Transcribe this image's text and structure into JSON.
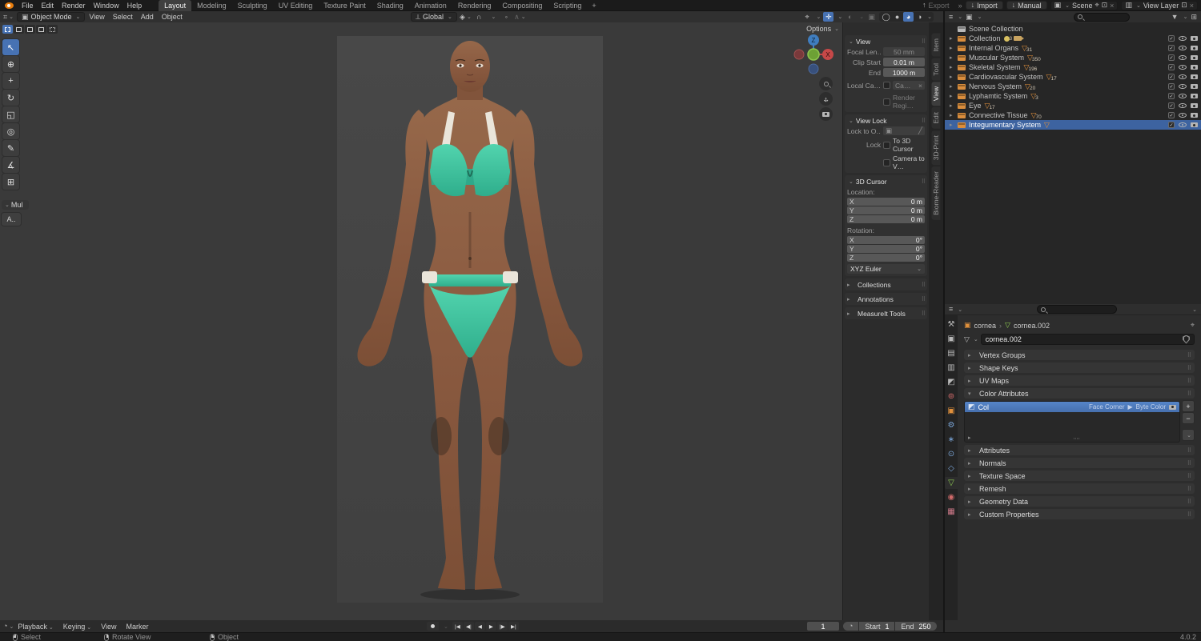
{
  "topbar": {
    "menus": [
      "File",
      "Edit",
      "Render",
      "Window",
      "Help"
    ],
    "workspaces": [
      {
        "label": "Layout",
        "active": true
      },
      {
        "label": "Modeling"
      },
      {
        "label": "Sculpting"
      },
      {
        "label": "UV Editing"
      },
      {
        "label": "Texture Paint"
      },
      {
        "label": "Shading"
      },
      {
        "label": "Animation"
      },
      {
        "label": "Rendering"
      },
      {
        "label": "Compositing"
      },
      {
        "label": "Scripting"
      }
    ],
    "new_workspace": "+",
    "export_label": "Export",
    "import_label": "Import",
    "manual_label": "Manual",
    "scene_label": "Scene",
    "view_layer_label": "View Layer"
  },
  "viewport_header": {
    "mode": "Object Mode",
    "menus": [
      "View",
      "Select",
      "Add",
      "Object"
    ],
    "orientation": "Global",
    "options_label": "Options"
  },
  "toolbar": {
    "tools": [
      {
        "name": "select-box",
        "glyph": "↖",
        "active": true
      },
      {
        "name": "cursor",
        "glyph": "⊕"
      },
      {
        "name": "move",
        "glyph": "+"
      },
      {
        "name": "rotate",
        "glyph": "↻"
      },
      {
        "name": "scale",
        "glyph": "◱"
      },
      {
        "name": "transform",
        "glyph": "◎"
      },
      {
        "name": "annotate",
        "glyph": "✎"
      },
      {
        "name": "measure",
        "glyph": "∡"
      },
      {
        "name": "add-cube",
        "glyph": "⊞"
      }
    ],
    "panel_label": "Mul",
    "panel_button": "A.."
  },
  "viewport": {
    "gizmo_z": "Z",
    "gizmo_x": "X"
  },
  "sidebar": {
    "tabs": [
      {
        "label": "Item"
      },
      {
        "label": "Tool"
      },
      {
        "label": "View",
        "active": true
      },
      {
        "label": "Edit"
      },
      {
        "label": "3D-Print"
      },
      {
        "label": "Biome-Reader"
      }
    ],
    "view": {
      "title": "View",
      "focal_label": "Focal Len…",
      "focal_value": "50 mm",
      "clip_label": "Clip Start",
      "clip_value": "0.01 m",
      "end_label": "End",
      "end_value": "1000 m",
      "local_label": "Local Ca…",
      "local_value": "Ca…",
      "render_region": "Render Regi…"
    },
    "view_lock": {
      "title": "View Lock",
      "lock_to": "Lock to O…",
      "lock_label": "Lock",
      "to_cursor": "To 3D Cursor",
      "camera_to": "Camera to V…"
    },
    "cursor": {
      "title": "3D Cursor",
      "location_label": "Location:",
      "location": [
        {
          "axis": "X",
          "value": "0 m"
        },
        {
          "axis": "Y",
          "value": "0 m"
        },
        {
          "axis": "Z",
          "value": "0 m"
        }
      ],
      "rotation_label": "Rotation:",
      "rotation": [
        {
          "axis": "X",
          "value": "0°"
        },
        {
          "axis": "Y",
          "value": "0°"
        },
        {
          "axis": "Z",
          "value": "0°"
        }
      ],
      "euler": "XYZ Euler"
    },
    "collapsed_panels": [
      "Collections",
      "Annotations",
      "MeasureIt Tools"
    ]
  },
  "outliner": {
    "root": "Scene Collection",
    "rows": [
      {
        "label": "Collection",
        "light_count": "3",
        "camera": true
      },
      {
        "label": "Internal Organs",
        "mesh": true,
        "mesh_count": "31"
      },
      {
        "label": "Muscular System",
        "mesh": true,
        "mesh_count": "350"
      },
      {
        "label": "Skeletal System",
        "mesh": true,
        "mesh_count": "196"
      },
      {
        "label": "Cardiovascular System",
        "mesh": true,
        "mesh_count": "17"
      },
      {
        "label": "Nervous System",
        "mesh": true,
        "mesh_count": "20"
      },
      {
        "label": "Lyphamtic System",
        "mesh": true,
        "mesh_count": "3"
      },
      {
        "label": "Eye",
        "mesh": true,
        "mesh_count": "17"
      },
      {
        "label": "Connective Tissue",
        "mesh": true,
        "mesh_count": "70"
      },
      {
        "label": "Integumentary System",
        "mesh": true,
        "mesh_count": "",
        "selected": true
      }
    ]
  },
  "properties": {
    "tabs": [
      {
        "name": "tool",
        "glyph": "⚒",
        "cls": "c-gray"
      },
      {
        "name": "render",
        "glyph": "▣",
        "cls": "c-gray"
      },
      {
        "name": "output",
        "glyph": "▤",
        "cls": "c-gray"
      },
      {
        "name": "view-layer",
        "glyph": "▥",
        "cls": "c-gray"
      },
      {
        "name": "scene",
        "glyph": "◩",
        "cls": "c-gray"
      },
      {
        "name": "world",
        "glyph": "⊚",
        "cls": "c-red"
      },
      {
        "name": "object",
        "glyph": "▣",
        "cls": "c-orange"
      },
      {
        "name": "modifiers",
        "glyph": "⚙",
        "cls": "c-blue"
      },
      {
        "name": "particles",
        "glyph": "∗",
        "cls": "c-blue"
      },
      {
        "name": "physics",
        "glyph": "⊙",
        "cls": "c-blue"
      },
      {
        "name": "constraints",
        "glyph": "◇",
        "cls": "c-blue"
      },
      {
        "name": "object-data",
        "glyph": "▽",
        "cls": "c-green",
        "active": true
      },
      {
        "name": "material",
        "glyph": "◉",
        "cls": "c-red"
      },
      {
        "name": "texture",
        "glyph": "▦",
        "cls": "c-pink"
      }
    ],
    "breadcrumb": {
      "object": "cornea",
      "sep": "›",
      "data": "cornea.002"
    },
    "name_value": "cornea.002",
    "panels_above": [
      "Vertex Groups",
      "Shape Keys",
      "UV Maps"
    ],
    "color_attributes": {
      "title": "Color Attributes",
      "row": {
        "name": "Col",
        "domain": "Face Corner",
        "arrow": "▶",
        "type": "Byte Color"
      },
      "add": "+",
      "remove": "−"
    },
    "panels_below": [
      "Attributes",
      "Normals",
      "Texture Space",
      "Remesh",
      "Geometry Data",
      "Custom Properties"
    ]
  },
  "timeline": {
    "menus": [
      {
        "label": "Playback",
        "dd": true
      },
      {
        "label": "Keying",
        "dd": true
      },
      {
        "label": "View"
      },
      {
        "label": "Marker"
      }
    ],
    "transport": [
      {
        "name": "jump-to-start",
        "glyph": "|◀"
      },
      {
        "name": "prev-keyframe",
        "glyph": "◀|"
      },
      {
        "name": "play-reverse",
        "glyph": "◀"
      },
      {
        "name": "play",
        "glyph": "▶"
      },
      {
        "name": "next-keyframe",
        "glyph": "|▶"
      },
      {
        "name": "jump-to-end",
        "glyph": "▶|"
      }
    ],
    "frame": "1",
    "start_label": "Start",
    "start_value": "1",
    "end_label": "End",
    "end_value": "250"
  },
  "statusbar": {
    "items": [
      {
        "label": "Select",
        "btn": "m-left"
      },
      {
        "label": "Rotate View",
        "btn": "m-mid"
      },
      {
        "label": "Object",
        "btn": "m-right"
      }
    ],
    "version": "4.0.2"
  },
  "colors": {
    "selection_blue": "#4772b3",
    "collection_orange": "#e0903c",
    "mesh_green": "#8fce52",
    "bikini_teal": "#3fc9a4",
    "skin_tone": "#8a5a40"
  }
}
